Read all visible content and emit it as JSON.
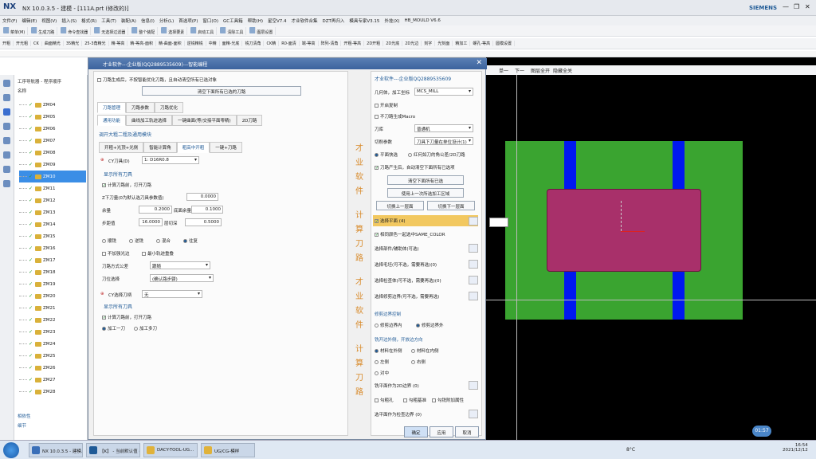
{
  "titlebar": {
    "logo": "NX",
    "title": "NX 10.0.3.5 - 建模 - [111A.prt (修改的)]",
    "brand": "SIEMENS",
    "minimize": "—",
    "restore": "❐",
    "close": "✕"
  },
  "menu": [
    "文件(F)",
    "编辑(E)",
    "视图(V)",
    "插入(S)",
    "格式(R)",
    "工具(T)",
    "装配(A)",
    "信息(I)",
    "分析(L)",
    "首选项(P)",
    "窗口(O)",
    "GC工具箱",
    "帮助(H)",
    "星空V7.4",
    "才业软件合集",
    "DZT再归入",
    "模具专家V3.15",
    "外挂(X)",
    "HB_MOULD V6.6"
  ],
  "toolbar1": [
    "菜单(M)",
    "生成刀路",
    "命令查找器",
    "无选择过滤器",
    "整个装配",
    "选择要素",
    "启动工具",
    "清除工具",
    "图层设置"
  ],
  "toolbar2": [
    "开粗",
    "开光粗",
    "CK",
    "曲面精光",
    "35精光",
    "25-3角精光",
    "精-等高",
    "精-等高-面积",
    "精-曲面-面积",
    "逆铣精铣",
    "中精",
    "面精-光底",
    "铣刀清角",
    "CK精",
    "R0-面清",
    "端-等高",
    "阵列-清角",
    "开粗-等高",
    "2D开粗",
    "2D光底",
    "2D光边",
    "刻字",
    "光刻面",
    "精加工",
    "螺孔-等高",
    "圆模设置"
  ],
  "nav": {
    "header": "工序导航器 - 程序顺序",
    "column": "名称",
    "items": [
      "ZM04",
      "ZM05",
      "ZM06",
      "ZM07",
      "ZM08",
      "ZM09",
      "ZM10",
      "ZM11",
      "ZM12",
      "ZM13",
      "ZM14",
      "ZM15",
      "ZM16",
      "ZM17",
      "ZM18",
      "ZM19",
      "ZM20",
      "ZM21",
      "ZM22",
      "ZM23",
      "ZM24",
      "ZM25",
      "ZM26",
      "ZM27",
      "ZM28"
    ],
    "selected": "ZM10",
    "foot1": "相依性",
    "foot2": "细节"
  },
  "dialog": {
    "title": "才业软件---企业版(QQ2889535609)---智能编程",
    "close": "✕",
    "top_check": "刀路生成后，不按智能优化刀路，且自动清空所有已选对象",
    "top_btn": "清空下面所有已选的刀路",
    "tabs1": [
      "刀路管理",
      "刀路参数",
      "刀路优化"
    ],
    "tabs2": [
      "通用功能",
      "曲线加工轨迹选择",
      "一键曲面(等/交接平面零精)",
      "2D刀路"
    ],
    "section1": "调开大粗二粗及通用模块",
    "tabs3": [
      "开粗+光顶+光侧",
      "智能计算角",
      "粗高中开粗",
      "一键+刀路"
    ],
    "cutter_label": "CY刀具(D)",
    "cutter_value": "1: D16R0.8",
    "show_all": "显示所有刀具",
    "calc_check": "计算刀路前，打开刀路",
    "fields": [
      {
        "label": "Z下刀量(0为默认选刀具参数值)",
        "value": "0.0000"
      },
      {
        "label": "余量",
        "value": "0.2000",
        "label2": "底面余量",
        "value2": "0.1000"
      },
      {
        "label": "步距值",
        "value": "16.0000",
        "label2": "层切深",
        "value2": "0.5000"
      }
    ],
    "radio_modes": [
      "顺铣",
      "逆铣",
      "混合",
      "往复"
    ],
    "check_a": "不加强光边",
    "check_b": "最小轨迹重叠",
    "drop1_label": "刀路方式公差",
    "drop1_value": "跟随",
    "drop2_label": "刀位选择",
    "drop2_value": "(确认路步骤)",
    "tool_label": "CY选择刀柄",
    "tool_value": "无",
    "show_all2": "显示所有刀具",
    "calc_check2": "计算刀路前，打开刀路",
    "radio_b1": "加工一刀",
    "radio_b2": "加工多刀",
    "orange": [
      "才",
      "业",
      "软",
      "件",
      "计",
      "算",
      "刀",
      "路",
      "才",
      "业",
      "软",
      "件",
      "计",
      "算",
      "刀",
      "路"
    ],
    "right": {
      "header": "才业软件---企业版QQ2889535609",
      "coord_label": "几何体，加工坐标",
      "coord_value": "MCS_MILL",
      "cb1": "开启复制",
      "cb2": "不刀路生成Macro",
      "ref_label": "刀库",
      "ref_value": "普通机",
      "cut_label": "切削参数",
      "cut_value": "刀具下刀量在单位设计(1)",
      "opt1": "平面快选",
      "opt2": "红何如刀的角公差/2D刀路",
      "check_gen": "刀路产生后，自动清空下面所有已选项",
      "btn_clear": "清空下面所有已选",
      "btn_reuse": "使用上一次所选加工区域",
      "btn_prev": "切换上一层面",
      "btn_next": "切换下一层面",
      "sel_plane": "选择平面 (4)",
      "sel_color": "相同颜色一起选中SAME_COLOR",
      "rows": [
        "选择部件/辅助体(可选)",
        "选择毛坯(可不选，需要再选)(0)",
        "选择检查体(可不选，需要再选)(0)",
        "选择修剪边界(可不选，需要再选)"
      ],
      "boundary_title": "修剪边界控制",
      "b_opt1": "修剪边界内",
      "b_opt2": "修剪边界外",
      "side_title": "铣开边外侧，开放边方向",
      "side_opts": [
        "材料在外侧",
        "材料在内侧",
        "左侧",
        "右侧",
        "对中"
      ],
      "plane2d": "铣平面作为2D边界 (0)",
      "cbs": [
        "勾粗孔",
        "勾粗基准",
        "勾铣附加属性"
      ],
      "last": "选平面作为检查边界 (0)"
    },
    "ok": "确定",
    "apply": "应用",
    "cancel": "取消"
  },
  "viewport_toolbar": [
    "单一",
    "下一",
    "图层全开",
    "隐藏全关"
  ],
  "taskbar": {
    "items": [
      "NX 10.0.3.5 - 建模...",
      "【K】 - 当前默认值 (D)...",
      "DACY-TOOL-UG...",
      "UG/CG-模样"
    ],
    "temp": "8°C",
    "time": "16:54",
    "date": "2021/12/12",
    "timer": "01:57"
  }
}
